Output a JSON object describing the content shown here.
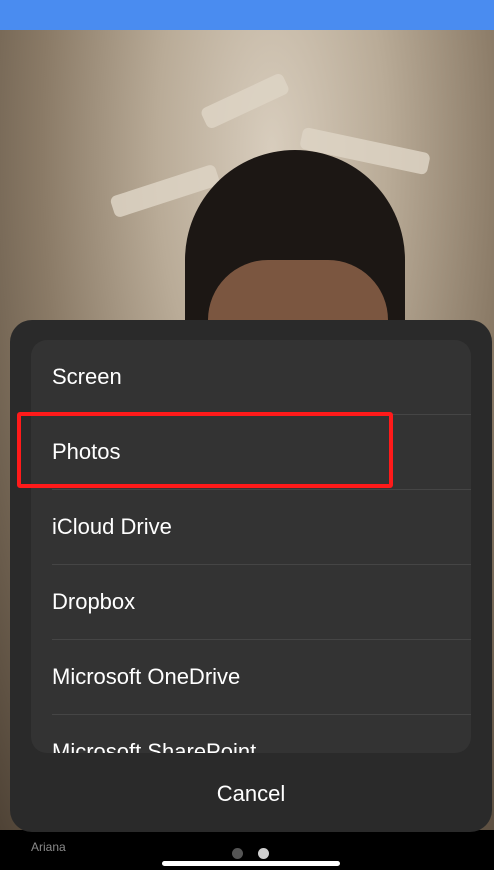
{
  "sheet": {
    "items": [
      {
        "label": "Screen"
      },
      {
        "label": "Photos"
      },
      {
        "label": "iCloud Drive"
      },
      {
        "label": "Dropbox"
      },
      {
        "label": "Microsoft OneDrive"
      },
      {
        "label": "Microsoft SharePoint"
      }
    ],
    "cancel_label": "Cancel",
    "highlighted_item": "Photos"
  },
  "participant": {
    "name": "Ariana"
  },
  "pager": {
    "count": 2,
    "active_index": 1
  },
  "colors": {
    "status_bar": "#4a8cf0",
    "sheet_bg": "#2a2a2a",
    "menu_bg": "#333333",
    "highlight": "#ff1a1a"
  }
}
